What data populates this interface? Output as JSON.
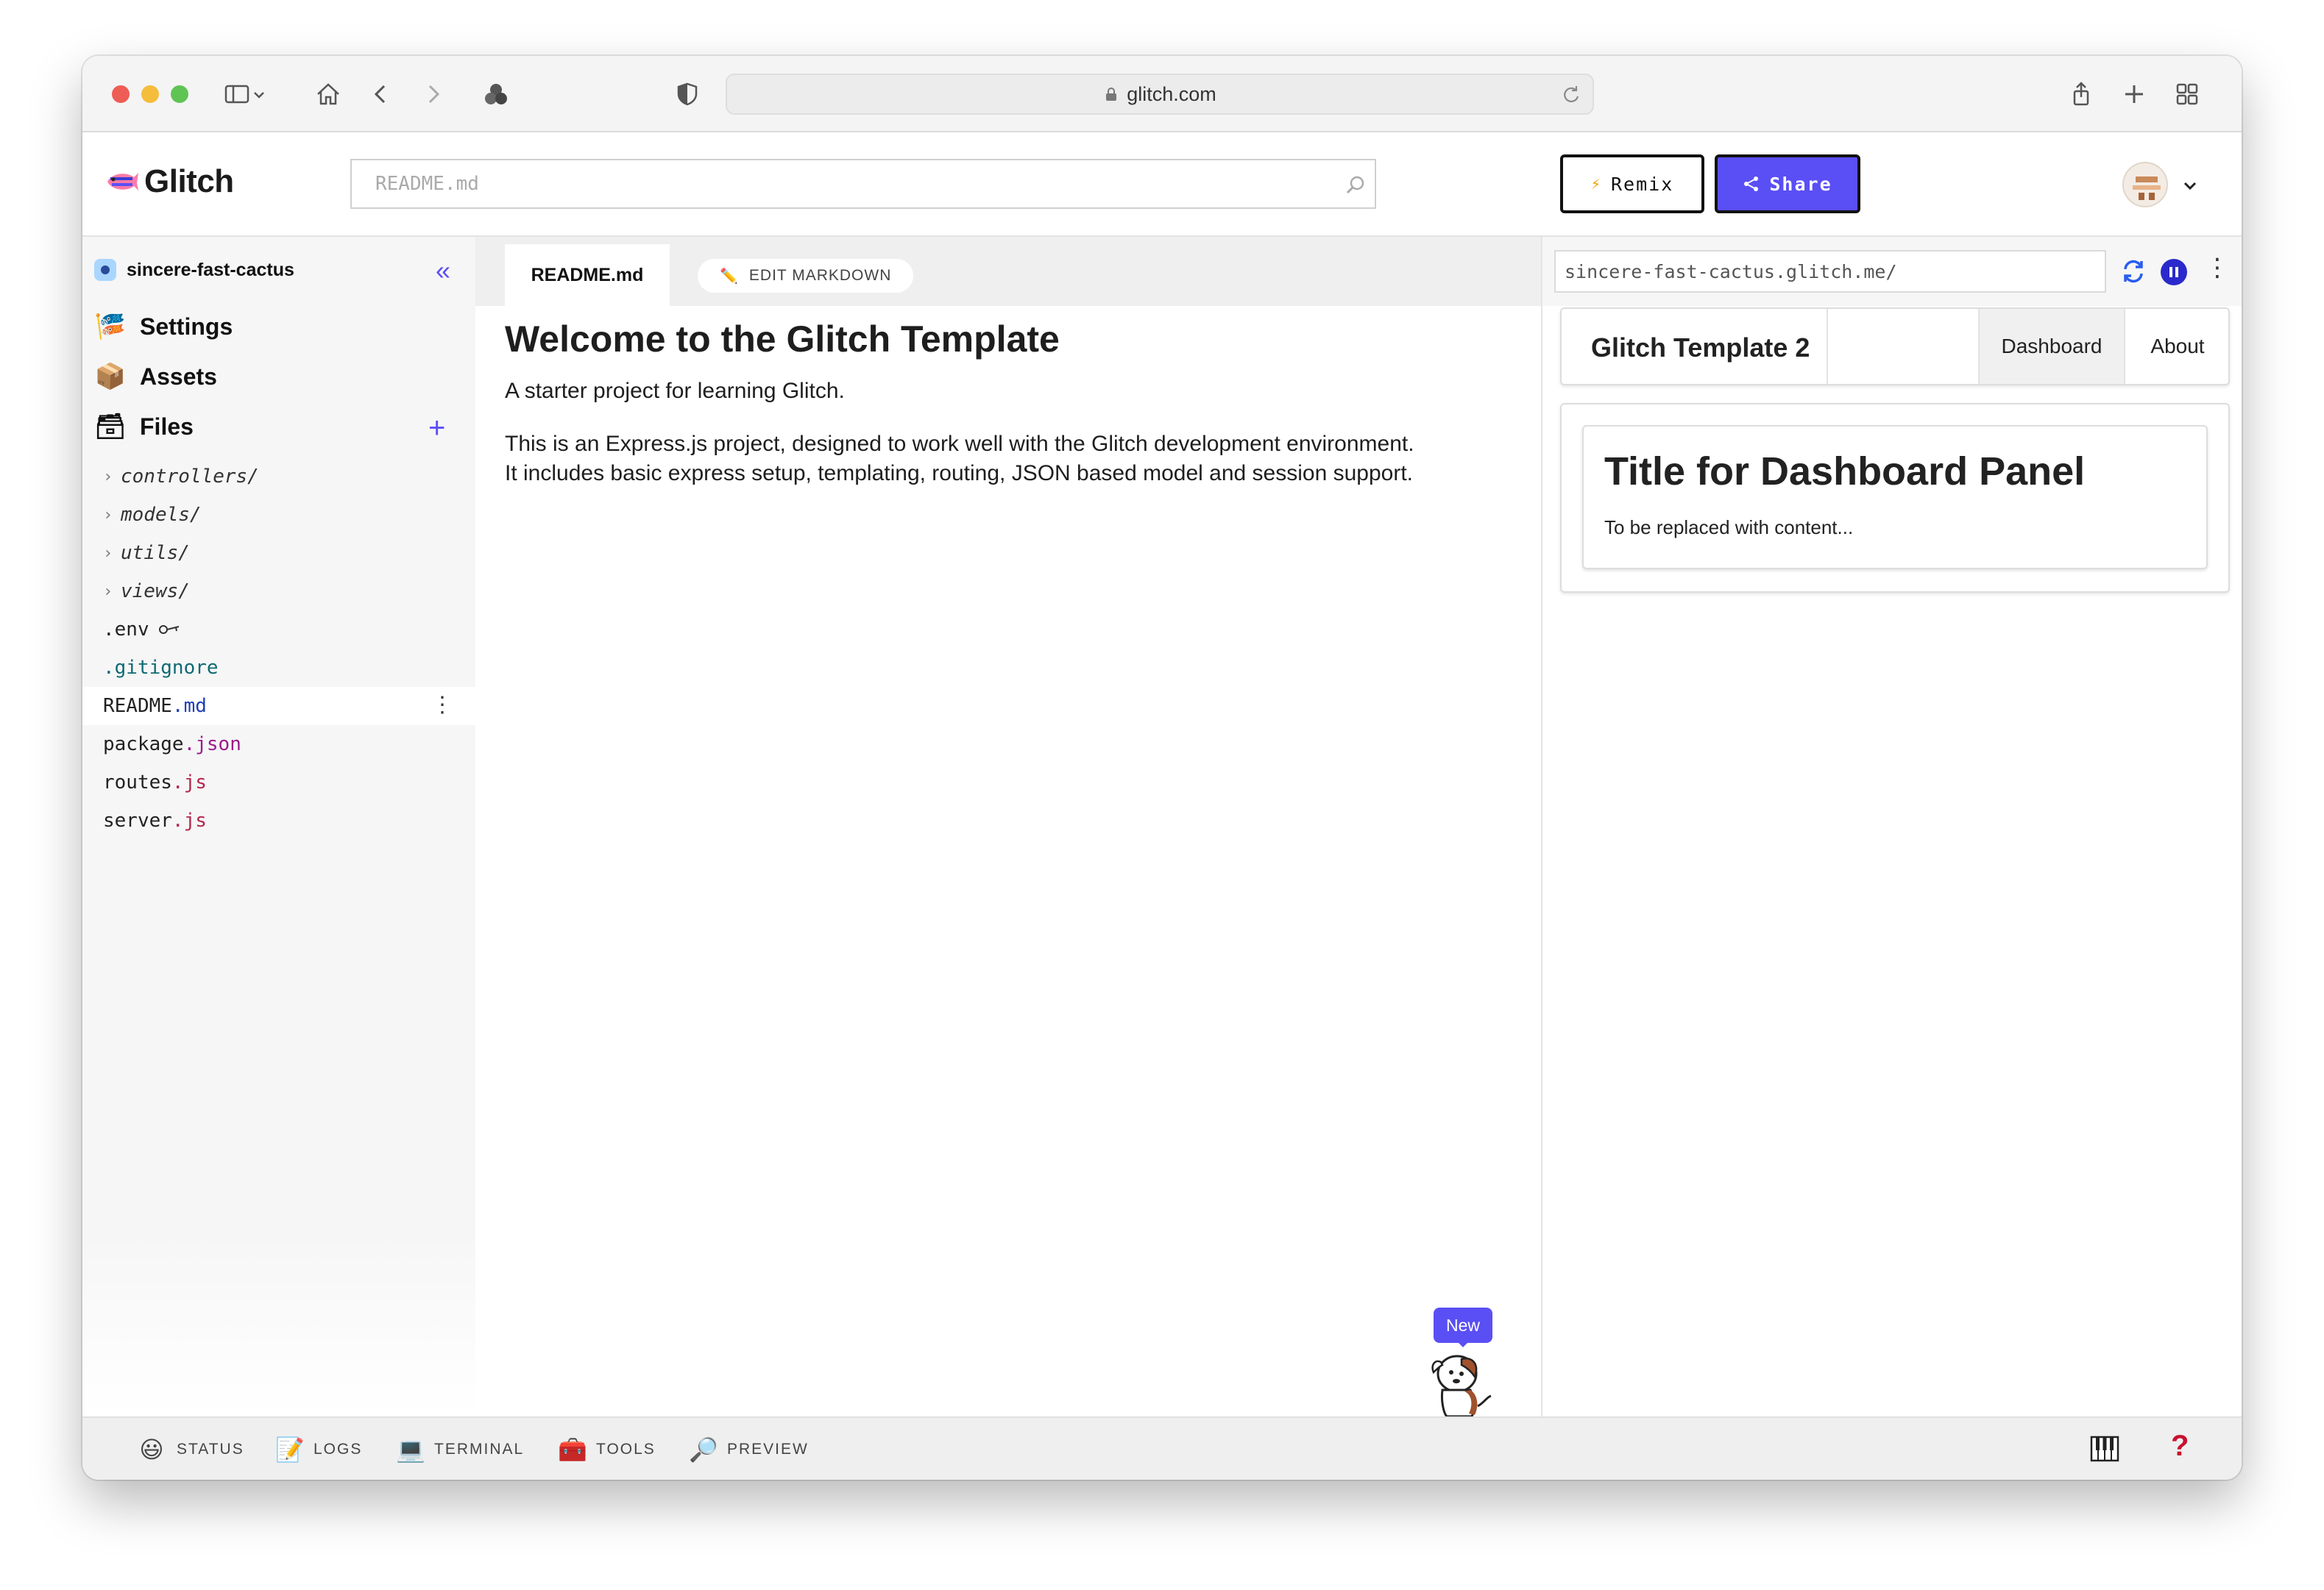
{
  "browser": {
    "url": "glitch.com"
  },
  "header": {
    "logo_text": "Glitch",
    "search_placeholder": "README.md",
    "remix_label": "Remix",
    "share_label": "Share"
  },
  "sidebar": {
    "project_name": "sincere-fast-cactus",
    "nav": [
      {
        "label": "Settings",
        "icon": "settings-icon"
      },
      {
        "label": "Assets",
        "icon": "box-icon"
      },
      {
        "label": "Files",
        "icon": "cabinet-icon"
      }
    ],
    "files": [
      {
        "name": "controllers/",
        "type": "folder"
      },
      {
        "name": "models/",
        "type": "folder"
      },
      {
        "name": "utils/",
        "type": "folder"
      },
      {
        "name": "views/",
        "type": "folder"
      },
      {
        "name": ".env",
        "type": "file",
        "icon": "key-icon"
      },
      {
        "name": ".gitignore",
        "type": "file"
      },
      {
        "base": "README",
        "ext": ".md",
        "type": "file",
        "selected": true
      },
      {
        "base": "package",
        "ext": ".json",
        "type": "file"
      },
      {
        "base": "routes",
        "ext": ".js",
        "type": "file"
      },
      {
        "base": "server",
        "ext": ".js",
        "type": "file"
      }
    ]
  },
  "editor": {
    "tab_label": "README.md",
    "edit_button": "EDIT MARKDOWN",
    "heading": "Welcome to the Glitch Template",
    "paragraphs": [
      "A starter project for learning Glitch.",
      "This is an Express.js project, designed to work well with the Glitch development environment. It includes basic express setup, templating, routing, JSON based model and session support."
    ],
    "new_badge": "New"
  },
  "preview": {
    "url": "sincere-fast-cactus.glitch.me/",
    "nav_brand": "Glitch Template 2",
    "nav_items": [
      "Dashboard",
      "About"
    ],
    "card_title": "Title for Dashboard Panel",
    "card_text": "To be replaced with content..."
  },
  "bottom_bar": {
    "items": [
      {
        "label": "STATUS",
        "icon": "smiley-icon"
      },
      {
        "label": "LOGS",
        "icon": "memo-icon"
      },
      {
        "label": "TERMINAL",
        "icon": "laptop-icon"
      },
      {
        "label": "TOOLS",
        "icon": "toolbox-icon"
      },
      {
        "label": "PREVIEW",
        "icon": "magnifier-icon"
      }
    ],
    "help": "?"
  },
  "colors": {
    "accent": "#5a4ff4",
    "help_red": "#c8102e"
  }
}
